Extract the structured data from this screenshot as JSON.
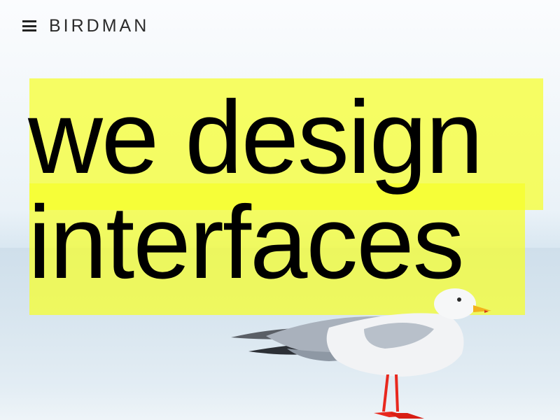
{
  "header": {
    "brand": "BIRDMAN",
    "menu_icon": "hamburger-menu-icon"
  },
  "hero": {
    "line1": "we design",
    "line2": "interfaces"
  },
  "colors": {
    "highlight": "#f6ff28",
    "text": "#000000",
    "sky": "#f4f8fb",
    "sea": "#cfe0ec"
  }
}
